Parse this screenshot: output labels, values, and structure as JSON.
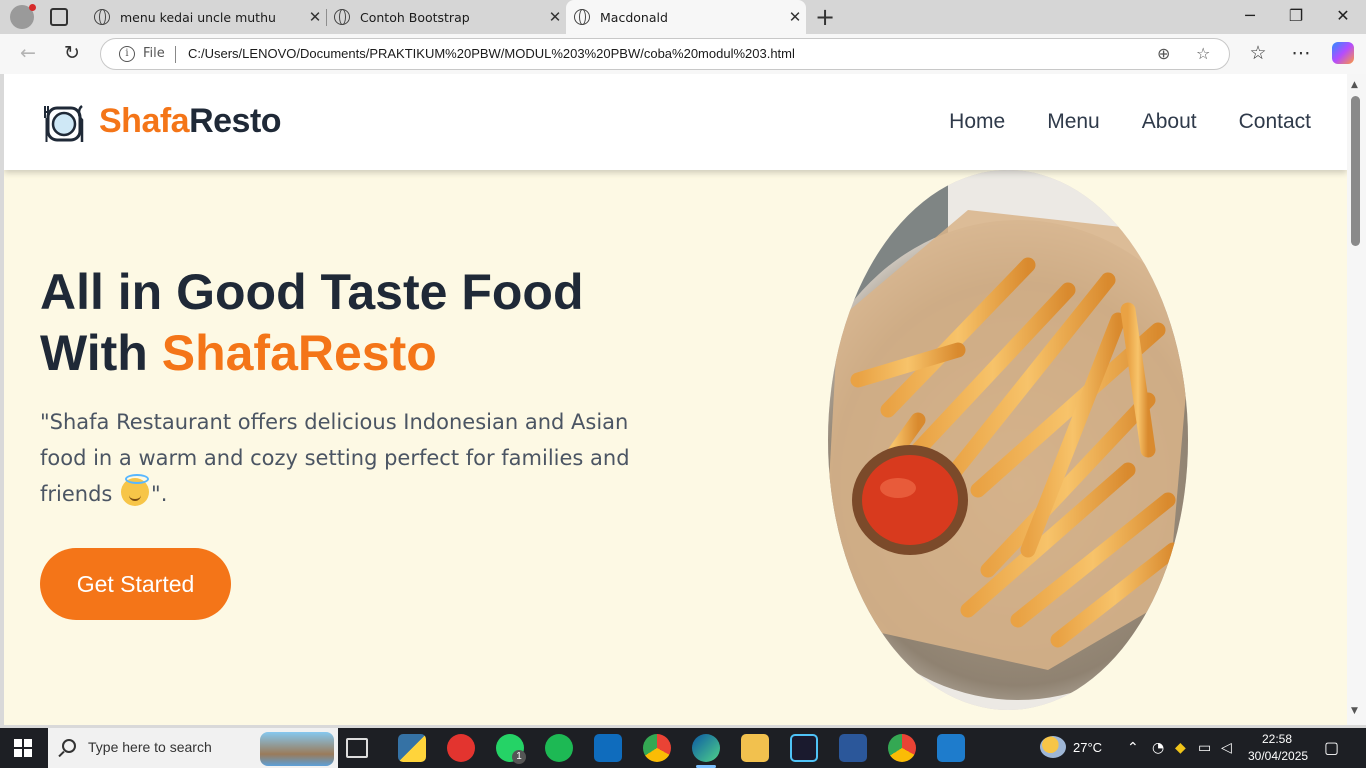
{
  "browser": {
    "tabs": [
      {
        "title": "menu kedai uncle muthu",
        "active": false
      },
      {
        "title": "Contoh Bootstrap",
        "active": false
      },
      {
        "title": "Macdonald",
        "active": true
      }
    ],
    "address": {
      "scheme_label": "File",
      "url": "C:/Users/LENOVO/Documents/PRAKTIKUM%20PBW/MODUL%203%20PBW/coba%20modul%203.html"
    }
  },
  "site": {
    "brand": {
      "part1": "Shafa",
      "part2": "Resto"
    },
    "nav": [
      "Home",
      "Menu",
      "About",
      "Contact"
    ],
    "hero": {
      "title_line1": "All in Good Taste Food",
      "title_line2_prefix": "With ",
      "title_line2_highlight": "ShafaResto",
      "text_before_emoji": "\"Shafa Restaurant offers delicious Indonesian and Asian food in a warm and cozy setting perfect for families and friends ",
      "text_after_emoji": "\".",
      "cta_label": "Get Started"
    },
    "colors": {
      "accent": "#f47518",
      "dark": "#1f2937",
      "background": "#fdf9e4"
    }
  },
  "taskbar": {
    "search_placeholder": "Type here to search",
    "weather": "27°C",
    "time": "22:58",
    "date": "30/04/2025",
    "whatsapp_badge": "1"
  }
}
